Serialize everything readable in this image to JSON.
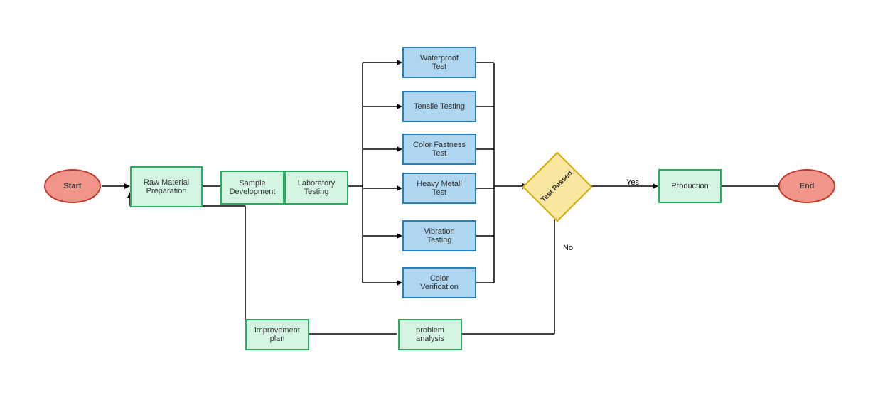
{
  "nodes": {
    "start": {
      "label": "Start"
    },
    "raw_material": {
      "label": "Raw Material\nPreparation"
    },
    "sample_dev": {
      "label": "Sample\nDevelopment"
    },
    "lab_testing": {
      "label": "Laboratory\nTesting"
    },
    "waterproof": {
      "label": "Waterproof\nTest"
    },
    "tensile": {
      "label": "Tensile Testing"
    },
    "color_fastness": {
      "label": "Color Fastness\nTest"
    },
    "heavy_metal": {
      "label": "Heavy Metall\nTest"
    },
    "vibration": {
      "label": "Vibration\nTesting"
    },
    "color_verif": {
      "label": "Color\nVerification"
    },
    "test_passed": {
      "label": "Test Passed"
    },
    "production": {
      "label": "Production"
    },
    "end": {
      "label": "End"
    },
    "problem_analysis": {
      "label": "problem\nanalysis"
    },
    "improvement_plan": {
      "label": "improvement\nplan"
    }
  },
  "edge_labels": {
    "yes": "Yes",
    "no": "No"
  }
}
